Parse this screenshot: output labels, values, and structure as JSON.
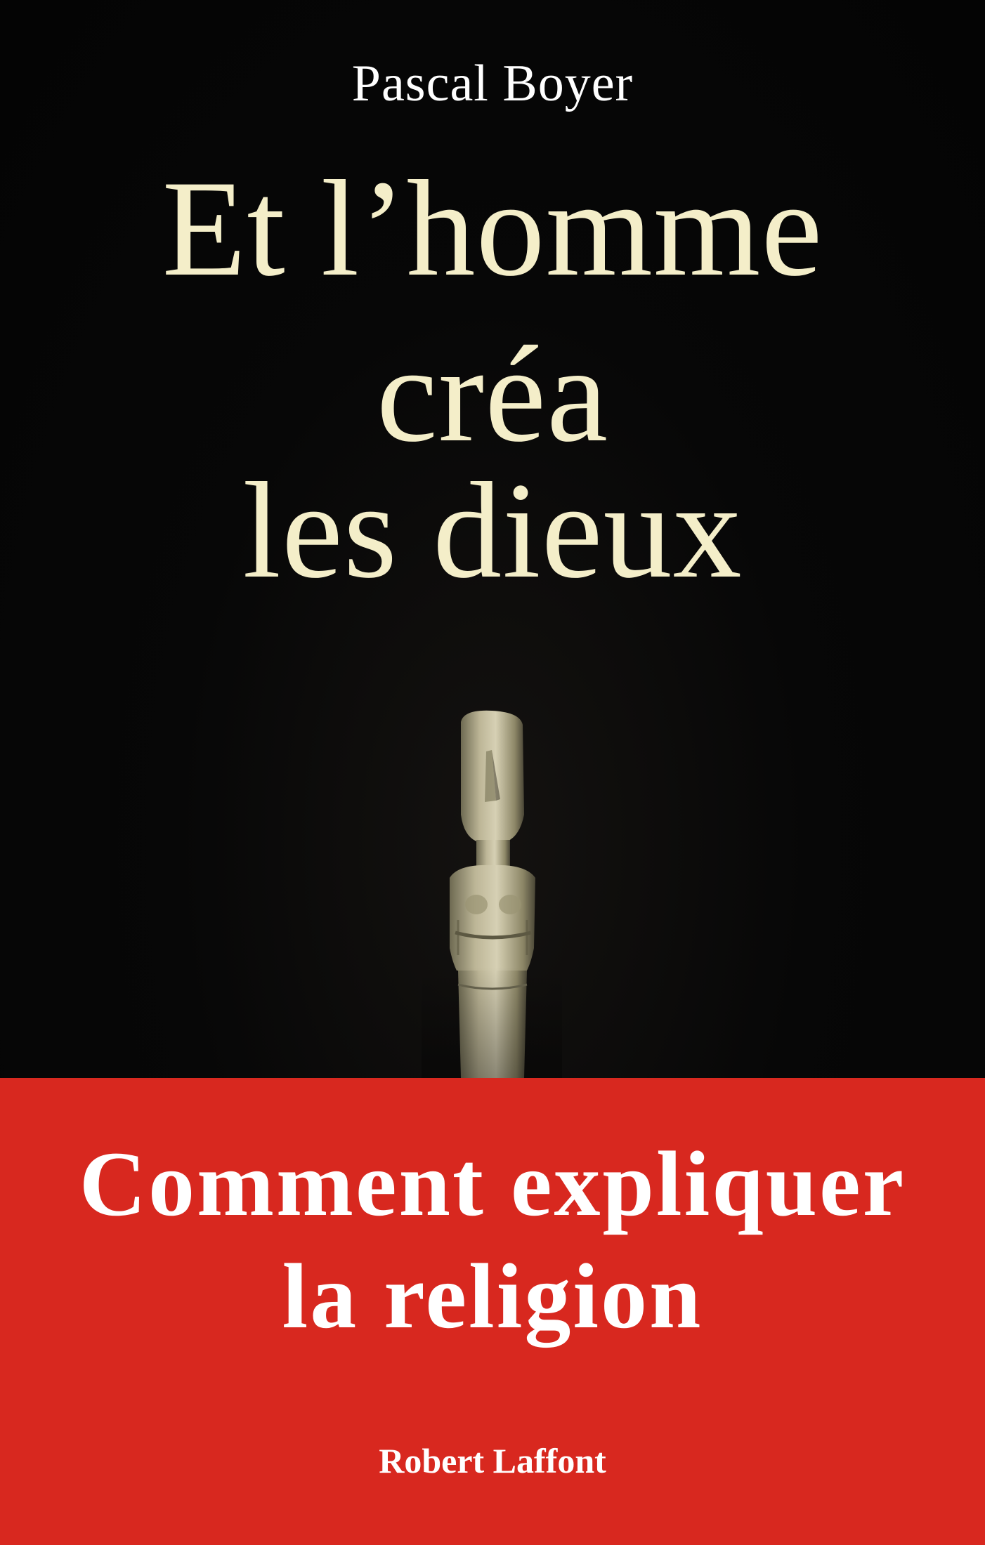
{
  "cover": {
    "author": "Pascal Boyer",
    "title_lines": [
      "Et l’homme",
      "créa",
      "les dieux"
    ],
    "subtitle_lines": [
      "Comment expliquer",
      "la religion"
    ],
    "publisher": "Robert Laffont",
    "colors": {
      "background": "#060606",
      "title": "#f4eec9",
      "band": "#d8281f",
      "text_white": "#ffffff"
    },
    "image": "cycladic-figurine"
  }
}
